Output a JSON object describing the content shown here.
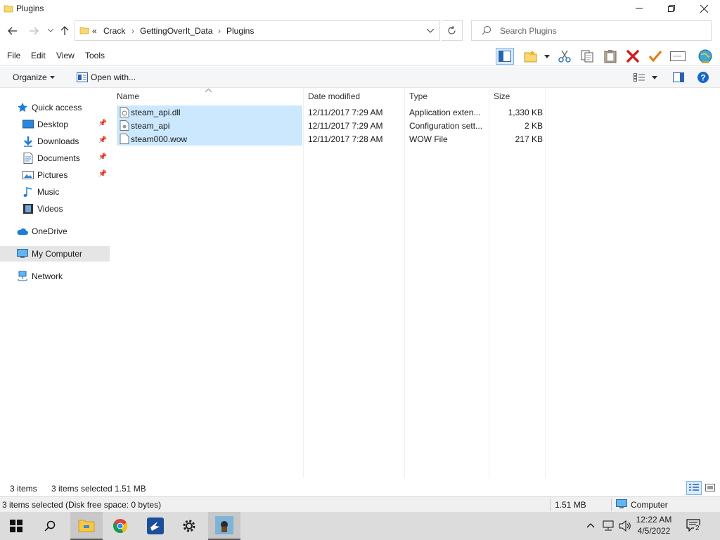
{
  "window": {
    "title": "Plugins"
  },
  "address": {
    "overflow": "«",
    "crumbs": [
      "Crack",
      "GettingOverIt_Data",
      "Plugins"
    ]
  },
  "search": {
    "placeholder": "Search Plugins"
  },
  "menu": {
    "file": "File",
    "edit": "Edit",
    "view": "View",
    "tools": "Tools"
  },
  "commands": {
    "organize": "Organize",
    "open_with": "Open with..."
  },
  "nav": {
    "quick_access": "Quick access",
    "desktop": "Desktop",
    "downloads": "Downloads",
    "documents": "Documents",
    "pictures": "Pictures",
    "music": "Music",
    "videos": "Videos",
    "onedrive": "OneDrive",
    "my_computer": "My Computer",
    "network": "Network"
  },
  "columns": {
    "name": "Name",
    "date": "Date modified",
    "type": "Type",
    "size": "Size"
  },
  "files": [
    {
      "name": "steam_api.dll",
      "date": "12/11/2017 7:29 AM",
      "type": "Application exten...",
      "size": "1,330 KB"
    },
    {
      "name": "steam_api",
      "date": "12/11/2017 7:29 AM",
      "type": "Configuration sett...",
      "size": "2 KB"
    },
    {
      "name": "steam000.wow",
      "date": "12/11/2017 7:28 AM",
      "type": "WOW File",
      "size": "217 KB"
    }
  ],
  "status": {
    "count": "3 items",
    "selected": "3 items selected",
    "size": "1.51 MB"
  },
  "details": {
    "text": "3 items selected (Disk free space: 0 bytes)",
    "size": "1.51 MB",
    "location": "Computer"
  },
  "clock": {
    "time": "12:22 AM",
    "date": "4/5/2022"
  },
  "notifications": {
    "count": "2"
  },
  "colors": {
    "selection": "#cce8ff",
    "accent": "#0078d7"
  }
}
